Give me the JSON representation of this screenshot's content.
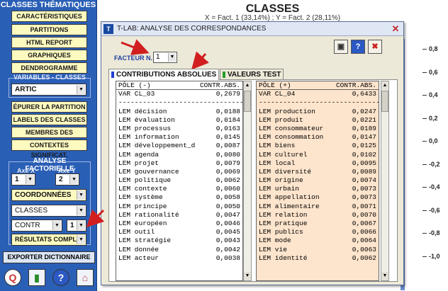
{
  "sidebar": {
    "title": "CLASSES THÉMATIQUES",
    "buttons": [
      "CARACTÉRISTIQUES",
      "PARTITIONS",
      "HTML REPORT",
      "GRAPHIQUES",
      "DENDROGRAMME"
    ],
    "variables_label": "VARIABLES - CLASSES",
    "variables_value": "ARTIC",
    "actions": [
      "ÉPURER LA PARTITION",
      "LABELS DES CLASSES",
      "MEMBRES DES CLASSES",
      "CONTEXTES SIGNIFICAT."
    ],
    "factor_section_label": "ANALYSE FACTORIELLE",
    "axe_x_label": "Axe X",
    "axe_y_label": "Axe Y",
    "axe_x_value": "1",
    "axe_y_value": "2",
    "coordonnees": "COORDONNÉES",
    "classes": "CLASSES",
    "contr": "CONTR",
    "contr_num": "1",
    "resultats": "RÉSULTATS COMPL",
    "export": "EXPORTER DICTIONNAIRE"
  },
  "chart": {
    "title": "CLASSES",
    "subtitle": "X = Fact. 1 (33,14%) ; Y = Fact. 2 (28,11%)",
    "ticks": [
      "0,8",
      "0,6",
      "0,4",
      "0,2",
      "0,0",
      "-0,2",
      "-0,4",
      "-0,6",
      "-0,8",
      "-1,0"
    ]
  },
  "dialog": {
    "title": "T-LAB: ANALYSE DES CORRESPONDANCES",
    "facteur_label": "FACTEUR N.",
    "facteur_value": "1",
    "tab_active": "CONTRIBUTIONS ABSOLUES",
    "tab_inactive": "VALEURS TEST",
    "left_header": {
      "pole": "PÔLE (-)",
      "contr": "CONTR.ABS."
    },
    "left_var": {
      "label": "VAR CL_03",
      "value": "0,2679"
    },
    "separator": "----------------------------------------",
    "left_rows": [
      {
        "label": "LEM décision",
        "value": "0,0188"
      },
      {
        "label": "LEM évaluation",
        "value": "0,0184"
      },
      {
        "label": "LEM processus",
        "value": "0,0163"
      },
      {
        "label": "LEM information",
        "value": "0,0145"
      },
      {
        "label": "LEM développement_d",
        "value": "0,0087"
      },
      {
        "label": "LEM agenda",
        "value": "0,0080"
      },
      {
        "label": "LEM projet",
        "value": "0,0079"
      },
      {
        "label": "LEM gouvernance",
        "value": "0,0069"
      },
      {
        "label": "LEM politique",
        "value": "0,0062"
      },
      {
        "label": "LEM contexte",
        "value": "0,0060"
      },
      {
        "label": "LEM système",
        "value": "0,0058"
      },
      {
        "label": "LEM principe",
        "value": "0,0050"
      },
      {
        "label": "LEM rationalité",
        "value": "0,0047"
      },
      {
        "label": "LEM européen",
        "value": "0,0046"
      },
      {
        "label": "LEM outil",
        "value": "0,0045"
      },
      {
        "label": "LEM stratégie",
        "value": "0,0043"
      },
      {
        "label": "LEM donnée",
        "value": "0,0042"
      },
      {
        "label": "LEM acteur",
        "value": "0,0038"
      }
    ],
    "right_header": {
      "pole": "PÔLE (+)",
      "contr": "CONTR.ABS."
    },
    "right_var": {
      "label": "VAR CL_04",
      "value": "0,6433"
    },
    "right_rows": [
      {
        "label": "LEM production",
        "value": "0,0247"
      },
      {
        "label": "LEM produit",
        "value": "0,0221"
      },
      {
        "label": "LEM consommateur",
        "value": "0,0189"
      },
      {
        "label": "LEM consommation",
        "value": "0,0147"
      },
      {
        "label": "LEM biens",
        "value": "0,0125"
      },
      {
        "label": "LEM culturel",
        "value": "0,0102"
      },
      {
        "label": "LEM local",
        "value": "0,0095"
      },
      {
        "label": "LEM diversité",
        "value": "0,0089"
      },
      {
        "label": "LEM origine",
        "value": "0,0074"
      },
      {
        "label": "LEM urbain",
        "value": "0,0073"
      },
      {
        "label": "LEM appellation",
        "value": "0,0073"
      },
      {
        "label": "LEM alimentaire",
        "value": "0,0071"
      },
      {
        "label": "LEM relation",
        "value": "0,0070"
      },
      {
        "label": "LEM pratique",
        "value": "0,0067"
      },
      {
        "label": "LEM publics",
        "value": "0,0066"
      },
      {
        "label": "LEM mode",
        "value": "0,0064"
      },
      {
        "label": "LEM vie",
        "value": "0,0063"
      },
      {
        "label": "LEM identité",
        "value": "0,0062"
      }
    ]
  },
  "colors": {
    "sidebar": "#2a5fb6",
    "button": "#fdfac0",
    "red_arrow": "#d11f1f"
  }
}
